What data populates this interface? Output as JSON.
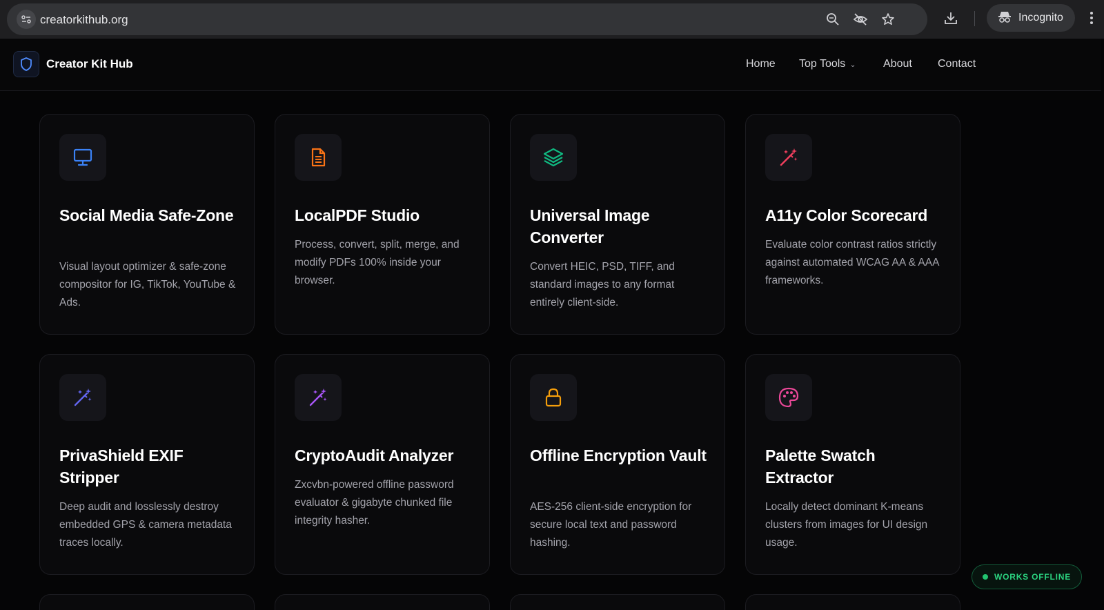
{
  "browser": {
    "url": "creatorkithub.org",
    "profile_label": "Incognito",
    "icons": [
      "site-info-icon",
      "zoom-icon",
      "eye-off-icon",
      "star-icon",
      "download-icon",
      "incognito-icon",
      "more-vert-icon"
    ]
  },
  "site": {
    "name": "Creator Kit Hub",
    "logo_icon": "shield-icon",
    "nav": {
      "home": "Home",
      "top_tools": "Top Tools",
      "about": "About",
      "contact": "Contact"
    }
  },
  "tools": [
    {
      "title": "Social Media Safe-Zone",
      "description": "Visual layout optimizer & safe-zone compositor for IG, TikTok, YouTube & Ads.",
      "icon": "monitor-icon",
      "color": "#3b82f6"
    },
    {
      "title": "LocalPDF Studio",
      "description": "Process, convert, split, merge, and modify PDFs 100% inside your browser.",
      "icon": "document-icon",
      "color": "#f97316"
    },
    {
      "title": "Universal Image Converter",
      "description": "Convert HEIC, PSD, TIFF, and standard images to any format entirely client-side.",
      "icon": "layers-icon",
      "color": "#10b981"
    },
    {
      "title": "A11y Color Scorecard",
      "description": "Evaluate color contrast ratios strictly against automated WCAG AA & AAA frameworks.",
      "icon": "magic-wand-icon",
      "color": "#f43f5e"
    },
    {
      "title": "PrivaShield EXIF Stripper",
      "description": "Deep audit and losslessly destroy embedded GPS & camera metadata traces locally.",
      "icon": "magic-wand-icon",
      "color": "#6366f1"
    },
    {
      "title": "CryptoAudit Analyzer",
      "description": "Zxcvbn-powered offline password evaluator & gigabyte chunked file integrity hasher.",
      "icon": "magic-wand-icon",
      "color": "#a855f7"
    },
    {
      "title": "Offline Encryption Vault",
      "description": "AES-256 client-side encryption for secure local text and password hashing.",
      "icon": "lock-icon",
      "color": "#f59e0b"
    },
    {
      "title": "Palette Swatch Extractor",
      "description": "Locally detect dominant K-means clusters from images for UI design usage.",
      "icon": "palette-icon",
      "color": "#ec4899"
    }
  ],
  "badge": {
    "label": "WORKS OFFLINE",
    "color": "#22c36f"
  }
}
